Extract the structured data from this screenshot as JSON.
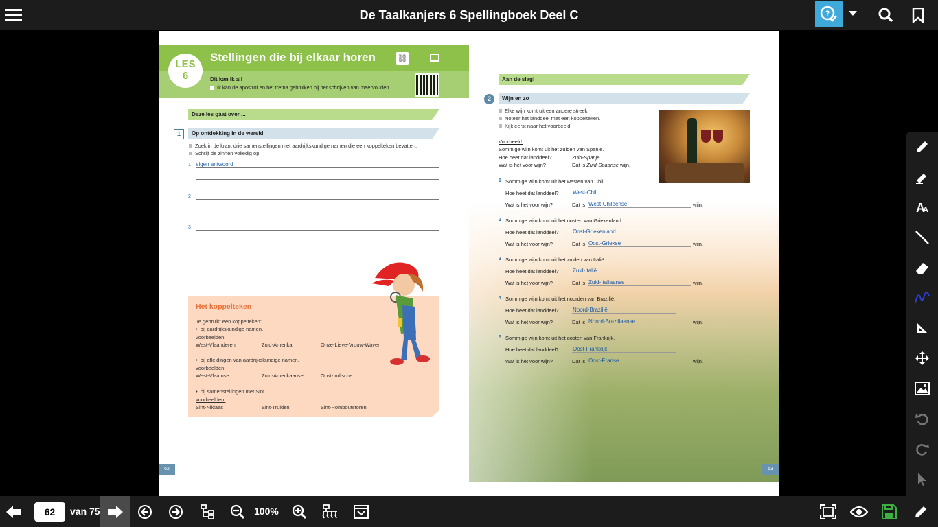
{
  "header": {
    "title": "De Taalkanjers 6 Spellingboek Deel C",
    "icons": [
      "hamburger-menu-icon",
      "help-check-icon",
      "caret-down-icon",
      "search-icon",
      "bookmark-icon"
    ]
  },
  "left_page": {
    "les_label": "LES",
    "les_number": "6",
    "title": "Stellingen die bij elkaar horen",
    "kan_title": "Dit kan ik al!",
    "kan_item": "Ik kan de apostrof en het trema gebruiken bij het schrijven van meervouden.",
    "band_intro": "Deze les gaat over ...",
    "ex1": {
      "number": "1",
      "title": "Op ontdekking in de wereld",
      "bullets": [
        "Zoek in de krant drie samenstellingen met aardrijkskundige namen die een koppelteken bevatten.",
        "Schrijf de zinnen volledig op."
      ],
      "line_numbers": [
        "1",
        "2",
        "3"
      ],
      "answer_1": "eigen antwoord"
    },
    "koppel": {
      "heading": "Het koppelteken",
      "intro": "Je gebruikt een koppelteken:",
      "rule1": "bij aardrijkskundige namen.",
      "voorbeelden": "voorbeelden:",
      "ex1": [
        "West-Vlaanderen",
        "Zuid-Amerika",
        "Onze-Lieve-Vrouw-Waver"
      ],
      "rule2": "bij afleidingen van aardrijkskundige namen.",
      "ex2": [
        "West-Vlaamse",
        "Zuid-Amerikaanse",
        "Oost-Indische"
      ],
      "rule3": "bij samenstellingen met Sint.",
      "ex3": [
        "Sint-Niklaas",
        "Sint-Truiden",
        "Sint-Romboutstoren"
      ]
    },
    "page_number": "62"
  },
  "right_page": {
    "band": "Aan de slag!",
    "ex2": {
      "number": "2",
      "title": "Wijn en zo",
      "bullets": [
        "Elke wijn komt uit een andere streek.",
        "Noteer het landdeel met een koppelteken.",
        "Kijk eerst naar het voorbeeld."
      ],
      "voorbeeld_label": "Voorbeeld:",
      "voorbeeld_line1": "Sommige wijn komt uit het zuiden van Spanje.",
      "voorbeeld_q1": "Hoe heet dat landdeel?",
      "voorbeeld_a1": "Zuid-Spanje",
      "voorbeeld_q2": "Wat is het voor wijn?",
      "voorbeeld_a2_pre": "Dat is ",
      "voorbeeld_a2_word": "Zuid-Spaanse",
      "voorbeeld_a2_post": " wijn."
    },
    "questions": [
      {
        "num": "1",
        "text": "Sommige wijn komt uit het westen van Chili.",
        "answer1": "West-Chili",
        "answer2": "West-Chileense"
      },
      {
        "num": "2",
        "text": "Sommige wijn komt uit het oosten van Griekenland.",
        "answer1": "Oost-Griekenland",
        "answer2": "Oost-Griekse"
      },
      {
        "num": "3",
        "text": "Sommige wijn komt uit het zuiden van Italië.",
        "answer1": "Zuid-Italië",
        "answer2": "Zuid-Italiaanse"
      },
      {
        "num": "4",
        "text": "Sommige wijn komt uit het noorden van Brazilië.",
        "answer1": "Noord-Brazilië",
        "answer2": "Noord-Braziliaanse"
      },
      {
        "num": "5",
        "text": "Sommige wijn komt uit het oosten van Frankrijk.",
        "answer1": "Oost-Frankrijk",
        "answer2": "Oost-Franse"
      }
    ],
    "q_label1": "Hoe heet dat landdeel?",
    "q_label2": "Wat is het voor wijn?",
    "dat_is": "Dat is",
    "wijn": "wijn.",
    "page_number": "63"
  },
  "tool_rail": [
    "pen-icon",
    "highlighter-icon",
    "text-icon",
    "line-icon",
    "eraser-icon",
    "freehand-icon",
    "ruler-icon",
    "move-icon",
    "image-icon",
    "undo-icon",
    "redo-icon",
    "pointer-icon"
  ],
  "bottom": {
    "page_value": "62",
    "van_label": "van 75",
    "zoom_label": "100%",
    "icons": [
      "back-arrow-icon",
      "go-arrow-icon",
      "previous-page-icon",
      "next-page-icon",
      "tree-view-icon",
      "zoom-out-icon",
      "zoom-in-icon",
      "network-icon",
      "presentation-icon",
      "fullscreen-icon",
      "eye-icon",
      "save-icon",
      "edit-icon"
    ]
  },
  "colors": {
    "accent_blue": "#3fa9d9",
    "lesson_green": "#8dc149",
    "koppel_peach": "#fcd9c0",
    "answer_blue": "#1a5ca8",
    "save_green": "#3cb043"
  }
}
